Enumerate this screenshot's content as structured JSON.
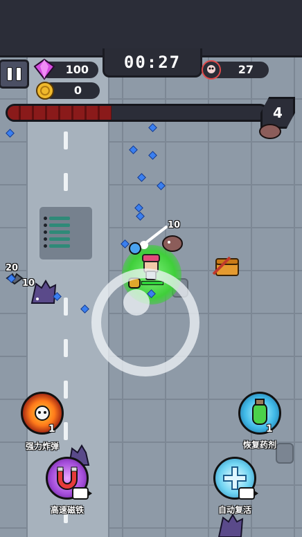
{
  "hud": {
    "timer": "00:27",
    "gems": "100",
    "coins": "0",
    "kills": "27",
    "level": "4",
    "xp_fraction": 0.4
  },
  "damage_numbers": [
    "10",
    "20",
    "10"
  ],
  "skills": {
    "bomb": {
      "label": "强力炸弹",
      "count": "1"
    },
    "potion": {
      "label": "恢复药剂",
      "count": "1"
    },
    "magnet": {
      "label": "高速磁铁"
    },
    "revive": {
      "label": "自动复活"
    }
  },
  "colors": {
    "xp_fill": "#7a1414",
    "gem": "#3a7ff0",
    "aura": "#3fcf3a",
    "hud_bg": "#2b2d38"
  },
  "icons": [
    "pause-icon",
    "gem-icon",
    "coin-icon",
    "skull-icon",
    "bomb-icon",
    "potion-icon",
    "magnet-icon",
    "revive-icon",
    "video-ad-icon"
  ]
}
